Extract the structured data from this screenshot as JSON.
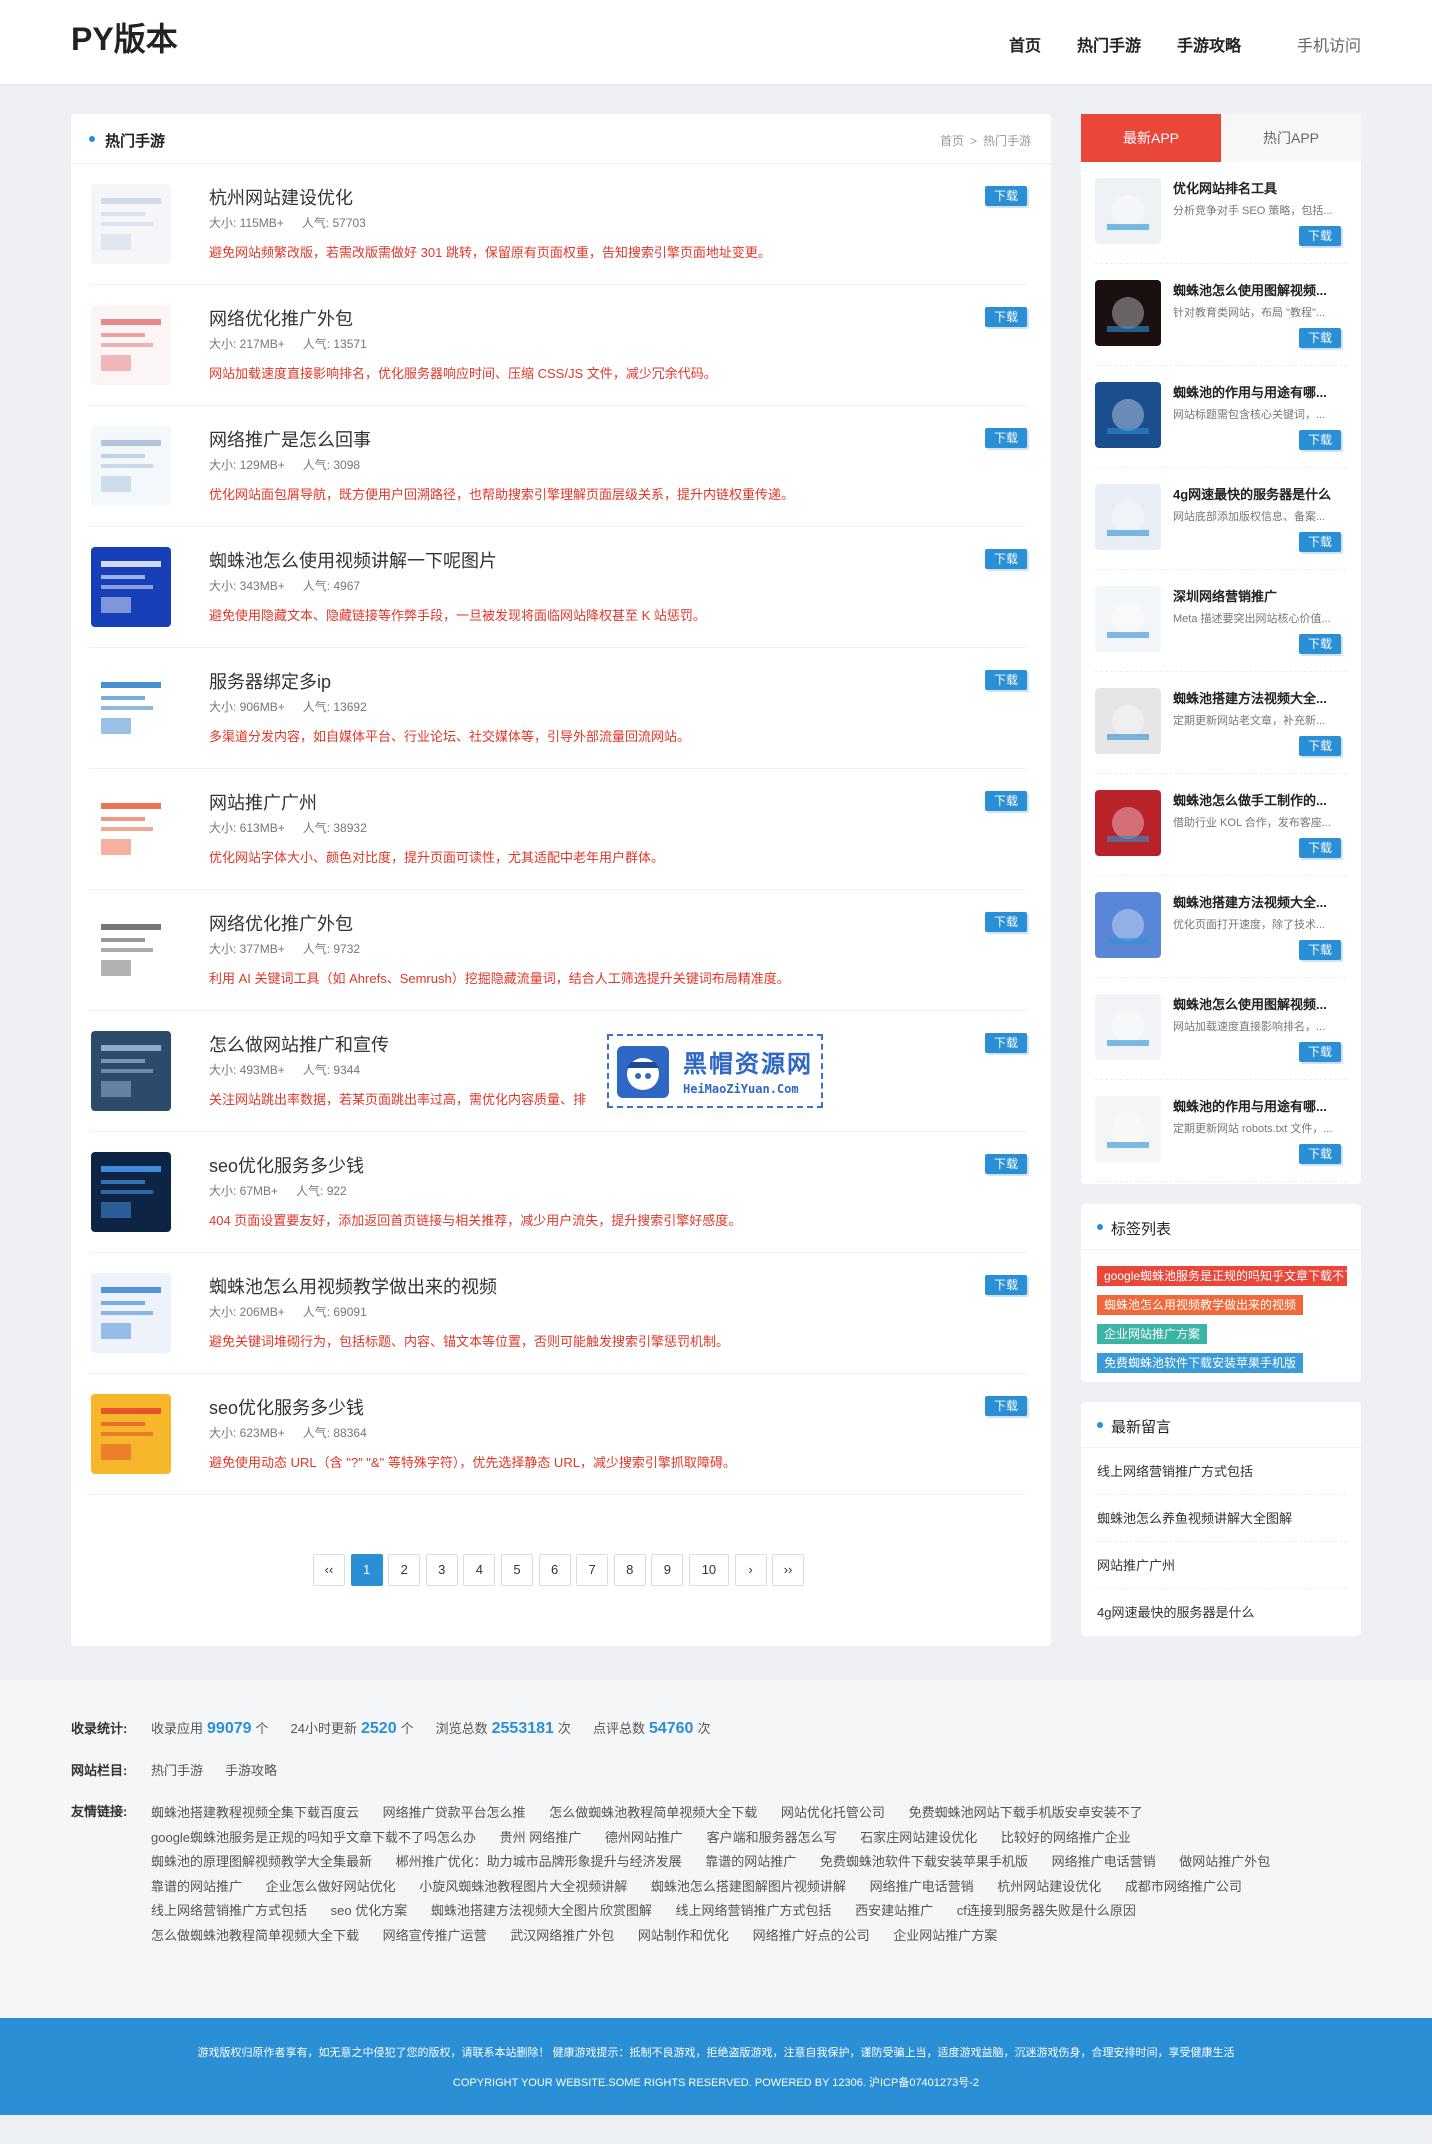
{
  "site": {
    "logo": "PY版本",
    "nav": [
      "首页",
      "热门手游",
      "手游攻略"
    ],
    "mobile": "手机访问"
  },
  "main": {
    "title": "热门手游",
    "breadcrumb": [
      "首页",
      ">",
      "热门手游"
    ],
    "download_label": "下载",
    "size_label": "大小:",
    "pop_label": "人气:",
    "items": [
      {
        "name": "杭州网站建设优化",
        "size": "115MB+",
        "pop": "57703",
        "desc": "避免网站频繁改版，若需改版需做好 301 跳转，保留原有页面权重，告知搜索引擎页面地址变更。"
      },
      {
        "name": "网络优化推广外包",
        "size": "217MB+",
        "pop": "13571",
        "desc": "网站加载速度直接影响排名，优化服务器响应时间、压缩 CSS/JS 文件，减少冗余代码。"
      },
      {
        "name": "网络推广是怎么回事",
        "size": "129MB+",
        "pop": "3098",
        "desc": "优化网站面包屑导航，既方便用户回溯路径，也帮助搜索引擎理解页面层级关系，提升内链权重传递。"
      },
      {
        "name": "蜘蛛池怎么使用视频讲解一下呢图片",
        "size": "343MB+",
        "pop": "4967",
        "desc": "避免使用隐藏文本、隐藏链接等作弊手段，一旦被发现将面临网站降权甚至 K 站惩罚。"
      },
      {
        "name": "服务器绑定多ip",
        "size": "906MB+",
        "pop": "13692",
        "desc": "多渠道分发内容，如自媒体平台、行业论坛、社交媒体等，引导外部流量回流网站。"
      },
      {
        "name": "网站推广广州",
        "size": "613MB+",
        "pop": "38932",
        "desc": "优化网站字体大小、颜色对比度，提升页面可读性，尤其适配中老年用户群体。"
      },
      {
        "name": "网络优化推广外包",
        "size": "377MB+",
        "pop": "9732",
        "desc": "利用 AI 关键词工具（如 Ahrefs、Semrush）挖掘隐藏流量词，结合人工筛选提升关键词布局精准度。"
      },
      {
        "name": "怎么做网站推广和宣传",
        "size": "493MB+",
        "pop": "9344",
        "desc": "关注网站跳出率数据，若某页面跳出率过高，需优化内容质量、排"
      },
      {
        "name": "seo优化服务多少钱",
        "size": "67MB+",
        "pop": "922",
        "desc": "404 页面设置要友好，添加返回首页链接与相关推荐，减少用户流失，提升搜索引擎好感度。"
      },
      {
        "name": "蜘蛛池怎么用视频教学做出来的视频",
        "size": "206MB+",
        "pop": "69091",
        "desc": "避免关键词堆砌行为，包括标题、内容、锚文本等位置，否则可能触发搜索引擎惩罚机制。"
      },
      {
        "name": "seo优化服务多少钱",
        "size": "623MB+",
        "pop": "88364",
        "desc": "避免使用动态 URL（含 \"?\" \"&\" 等特殊字符），优先选择静态 URL，减少搜索引擎抓取障碍。"
      }
    ],
    "pager": [
      "‹‹",
      "1",
      "2",
      "3",
      "4",
      "5",
      "6",
      "7",
      "8",
      "9",
      "10",
      "›",
      "››"
    ],
    "watermark": {
      "cn": "黑帽资源网",
      "en": "HeiMaoZiYuan.Com"
    }
  },
  "sidebar": {
    "tabs": [
      "最新APP",
      "热门APP"
    ],
    "download_label": "下载",
    "apps": [
      {
        "name": "优化网站排名工具",
        "desc": "分析竞争对手 SEO 策略，包括..."
      },
      {
        "name": "蜘蛛池怎么使用图解视频...",
        "desc": "针对教育类网站，布局 \"教程\"..."
      },
      {
        "name": "蜘蛛池的作用与用途有哪...",
        "desc": "网站标题需包含核心关键词，..."
      },
      {
        "name": "4g网速最快的服务器是什么",
        "desc": "网站底部添加版权信息、备案..."
      },
      {
        "name": "深圳网络营销推广",
        "desc": "Meta 描述要突出网站核心价值..."
      },
      {
        "name": "蜘蛛池搭建方法视频大全...",
        "desc": "定期更新网站老文章，补充新..."
      },
      {
        "name": "蜘蛛池怎么做手工制作的...",
        "desc": "借助行业 KOL 合作，发布客座..."
      },
      {
        "name": "蜘蛛池搭建方法视频大全...",
        "desc": "优化页面打开速度，除了技术..."
      },
      {
        "name": "蜘蛛池怎么使用图解视频...",
        "desc": "网站加载速度直接影响排名，..."
      },
      {
        "name": "蜘蛛池的作用与用途有哪...",
        "desc": "定期更新网站 robots.txt 文件，..."
      }
    ],
    "tags_title": "标签列表",
    "tags": [
      {
        "text": "google蜘蛛池服务是正规的吗知乎文章下载不了吗怎么办",
        "color": "#e8473a"
      },
      {
        "text": "蜘蛛池怎么用视频教学做出来的视频",
        "color": "#f0693a"
      },
      {
        "text": "企业网站推广方案",
        "color": "#3cb4a4"
      },
      {
        "text": "免费蜘蛛池软件下载安装苹果手机版",
        "color": "#3a9bd6"
      }
    ],
    "msg_title": "最新留言",
    "messages": [
      "线上网络营销推广方式包括",
      "蜘蛛池怎么养鱼视频讲解大全图解",
      "网站推广广州",
      "4g网速最快的服务器是什么"
    ]
  },
  "info": {
    "stats_label": "收录统计:",
    "stats": [
      {
        "pre": "收录应用",
        "val": "99079",
        "post": "个"
      },
      {
        "pre": "24小时更新",
        "val": "2520",
        "post": "个"
      },
      {
        "pre": "浏览总数",
        "val": "2553181",
        "post": "次"
      },
      {
        "pre": "点评总数",
        "val": "54760",
        "post": "次"
      }
    ],
    "columns_label": "网站栏目:",
    "columns": [
      "热门手游",
      "手游攻略"
    ],
    "links_label": "友情链接:",
    "links": [
      "蜘蛛池搭建教程视频全集下载百度云",
      "网络推广贷款平台怎么推",
      "怎么做蜘蛛池教程简单视频大全下载",
      "网站优化托管公司",
      "免费蜘蛛池网站下载手机版安卓安装不了",
      "google蜘蛛池服务是正规的吗知乎文章下载不了吗怎么办",
      "贵州 网络推广",
      "德州网站推广",
      "客户端和服务器怎么写",
      "石家庄网站建设优化",
      "比较好的网络推广企业",
      "蜘蛛池的原理图解视频教学大全集最新",
      "郴州推广优化：助力城市品牌形象提升与经济发展",
      "靠谱的网站推广",
      "免费蜘蛛池软件下载安装苹果手机版",
      "网络推广电话营销",
      "做网站推广外包",
      "靠谱的网站推广",
      "企业怎么做好网站优化",
      "小旋风蜘蛛池教程图片大全视频讲解",
      "蜘蛛池怎么搭建图解图片视频讲解",
      "网络推广电话营销",
      "杭州网站建设优化",
      "成都市网络推广公司",
      "线上网络营销推广方式包括",
      "seo 优化方案",
      "蜘蛛池搭建方法视频大全图片欣赏图解",
      "线上网络营销推广方式包括",
      "西安建站推广",
      "cf连接到服务器失败是什么原因",
      "怎么做蜘蛛池教程简单视频大全下载",
      "网络宣传推广运营",
      "武汉网络推广外包",
      "网站制作和优化",
      "网络推广好点的公司",
      "企业网站推广方案"
    ]
  },
  "footer": {
    "line1": "游戏版权归原作者享有，如无意之中侵犯了您的版权，请联系本站删除！ 健康游戏提示：抵制不良游戏，拒绝盗版游戏，注意自我保护，谨防受骗上当，适度游戏益脑，沉迷游戏伤身，合理安排时间，享受健康生活",
    "line2": "COPYRIGHT YOUR WEBSITE.SOME RIGHTS RESERVED. POWERED BY 12306. 沪ICP备07401273号-2"
  }
}
